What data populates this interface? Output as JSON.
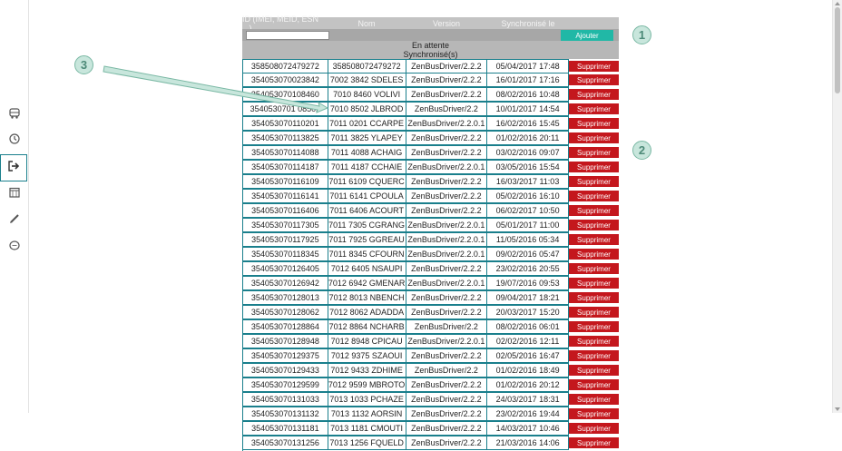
{
  "sidebar": {
    "items": [
      {
        "icon": "bus-icon"
      },
      {
        "icon": "history-icon"
      },
      {
        "icon": "logout-icon",
        "active": true
      },
      {
        "icon": "calendar-icon"
      },
      {
        "icon": "pencil-icon"
      },
      {
        "icon": "chat-icon"
      }
    ]
  },
  "table": {
    "headers": [
      "ID (IMEI, MEID, ESN ...)",
      "Nom",
      "Version",
      "Synchronisé le",
      ""
    ],
    "filter_value": "",
    "add_label": "Ajouter",
    "pending_label": "En attente",
    "synced_label": "Synchronisé(s)",
    "delete_label": "Supprimer",
    "rows": [
      {
        "id": "358508072479272",
        "nom": "358508072479272",
        "version": "ZenBusDriver/2.2.2",
        "sync": "05/04/2017 17:48"
      },
      {
        "id": "354053070023842",
        "nom": "7002 3842 SDELES",
        "version": "ZenBusDriver/2.2.2",
        "sync": "16/01/2017 17:16"
      },
      {
        "id": "354053070108460",
        "nom": "7010 8460 VOLIVI",
        "version": "ZenBusDriver/2.2.2",
        "sync": "08/02/2016 10:48"
      },
      {
        "id": "3540530701 08502",
        "nom": "7010 8502 JLBROD",
        "version": "ZenBusDriver/2.2",
        "sync": "10/01/2017 14:54"
      },
      {
        "id": "354053070110201",
        "nom": "7011 0201 CCARPE",
        "version": "ZenBusDriver/2.2.0.1",
        "sync": "16/02/2016 15:45"
      },
      {
        "id": "354053070113825",
        "nom": "7011 3825 YLAPEY",
        "version": "ZenBusDriver/2.2.2",
        "sync": "01/02/2016 20:11"
      },
      {
        "id": "354053070114088",
        "nom": "7011 4088 ACHAIG",
        "version": "ZenBusDriver/2.2.2",
        "sync": "03/02/2016 09:07"
      },
      {
        "id": "354053070114187",
        "nom": "7011 4187 CCHAIE",
        "version": "ZenBusDriver/2.2.0.1",
        "sync": "03/05/2016 15:54"
      },
      {
        "id": "354053070116109",
        "nom": "7011 6109 CQUERC",
        "version": "ZenBusDriver/2.2.2",
        "sync": "16/03/2017 11:03"
      },
      {
        "id": "354053070116141",
        "nom": "7011 6141 CPOULA",
        "version": "ZenBusDriver/2.2.2",
        "sync": "05/02/2016 16:10"
      },
      {
        "id": "354053070116406",
        "nom": "7011 6406 ACOURT",
        "version": "ZenBusDriver/2.2.2",
        "sync": "06/02/2017 10:50"
      },
      {
        "id": "354053070117305",
        "nom": "7011 7305 CGRANG",
        "version": "ZenBusDriver/2.2.0.1",
        "sync": "05/01/2017 11:00"
      },
      {
        "id": "354053070117925",
        "nom": "7011 7925 GGREAU",
        "version": "ZenBusDriver/2.2.0.1",
        "sync": "11/05/2016 05:34"
      },
      {
        "id": "354053070118345",
        "nom": "7011 8345 CFOURN",
        "version": "ZenBusDriver/2.2.0.1",
        "sync": "09/02/2016 05:47"
      },
      {
        "id": "354053070126405",
        "nom": "7012 6405 NSAUPI",
        "version": "ZenBusDriver/2.2.2",
        "sync": "23/02/2016 20:55"
      },
      {
        "id": "354053070126942",
        "nom": "7012 6942 GMENAR",
        "version": "ZenBusDriver/2.2.0.1",
        "sync": "19/07/2016 09:53"
      },
      {
        "id": "354053070128013",
        "nom": "7012 8013 NBENCH",
        "version": "ZenBusDriver/2.2.2",
        "sync": "09/04/2017 18:21"
      },
      {
        "id": "354053070128062",
        "nom": "7012 8062 ADADDA",
        "version": "ZenBusDriver/2.2.2",
        "sync": "20/03/2017 15:20"
      },
      {
        "id": "354053070128864",
        "nom": "7012 8864 NCHARB",
        "version": "ZenBusDriver/2.2",
        "sync": "08/02/2016 06:01"
      },
      {
        "id": "354053070128948",
        "nom": "7012 8948 CPICAU",
        "version": "ZenBusDriver/2.2.0.1",
        "sync": "02/02/2016 12:11"
      },
      {
        "id": "354053070129375",
        "nom": "7012 9375 SZAOUI",
        "version": "ZenBusDriver/2.2.2",
        "sync": "02/05/2016 16:47"
      },
      {
        "id": "354053070129433",
        "nom": "7012 9433 ZDHIME",
        "version": "ZenBusDriver/2.2",
        "sync": "01/02/2016 18:49"
      },
      {
        "id": "354053070129599",
        "nom": "7012 9599 MBROTO",
        "version": "ZenBusDriver/2.2.2",
        "sync": "01/02/2016 20:12"
      },
      {
        "id": "354053070131033",
        "nom": "7013 1033 PCHAZE",
        "version": "ZenBusDriver/2.2.2",
        "sync": "24/03/2017 18:31"
      },
      {
        "id": "354053070131132",
        "nom": "7013 1132 AORSIN",
        "version": "ZenBusDriver/2.2.2",
        "sync": "23/02/2016 19:44"
      },
      {
        "id": "354053070131181",
        "nom": "7013 1181 CMOUTI",
        "version": "ZenBusDriver/2.2.2",
        "sync": "14/03/2017 10:46"
      },
      {
        "id": "354053070131256",
        "nom": "7013 1256 FQUELD",
        "version": "ZenBusDriver/2.2.2",
        "sync": "21/03/2016 14:06"
      }
    ]
  },
  "callouts": [
    "1",
    "2",
    "3"
  ],
  "colors": {
    "accent": "#1a7f8c",
    "add_button": "#21b8a6",
    "delete_button": "#c4171d",
    "callout_fill": "#c8e6dc"
  }
}
